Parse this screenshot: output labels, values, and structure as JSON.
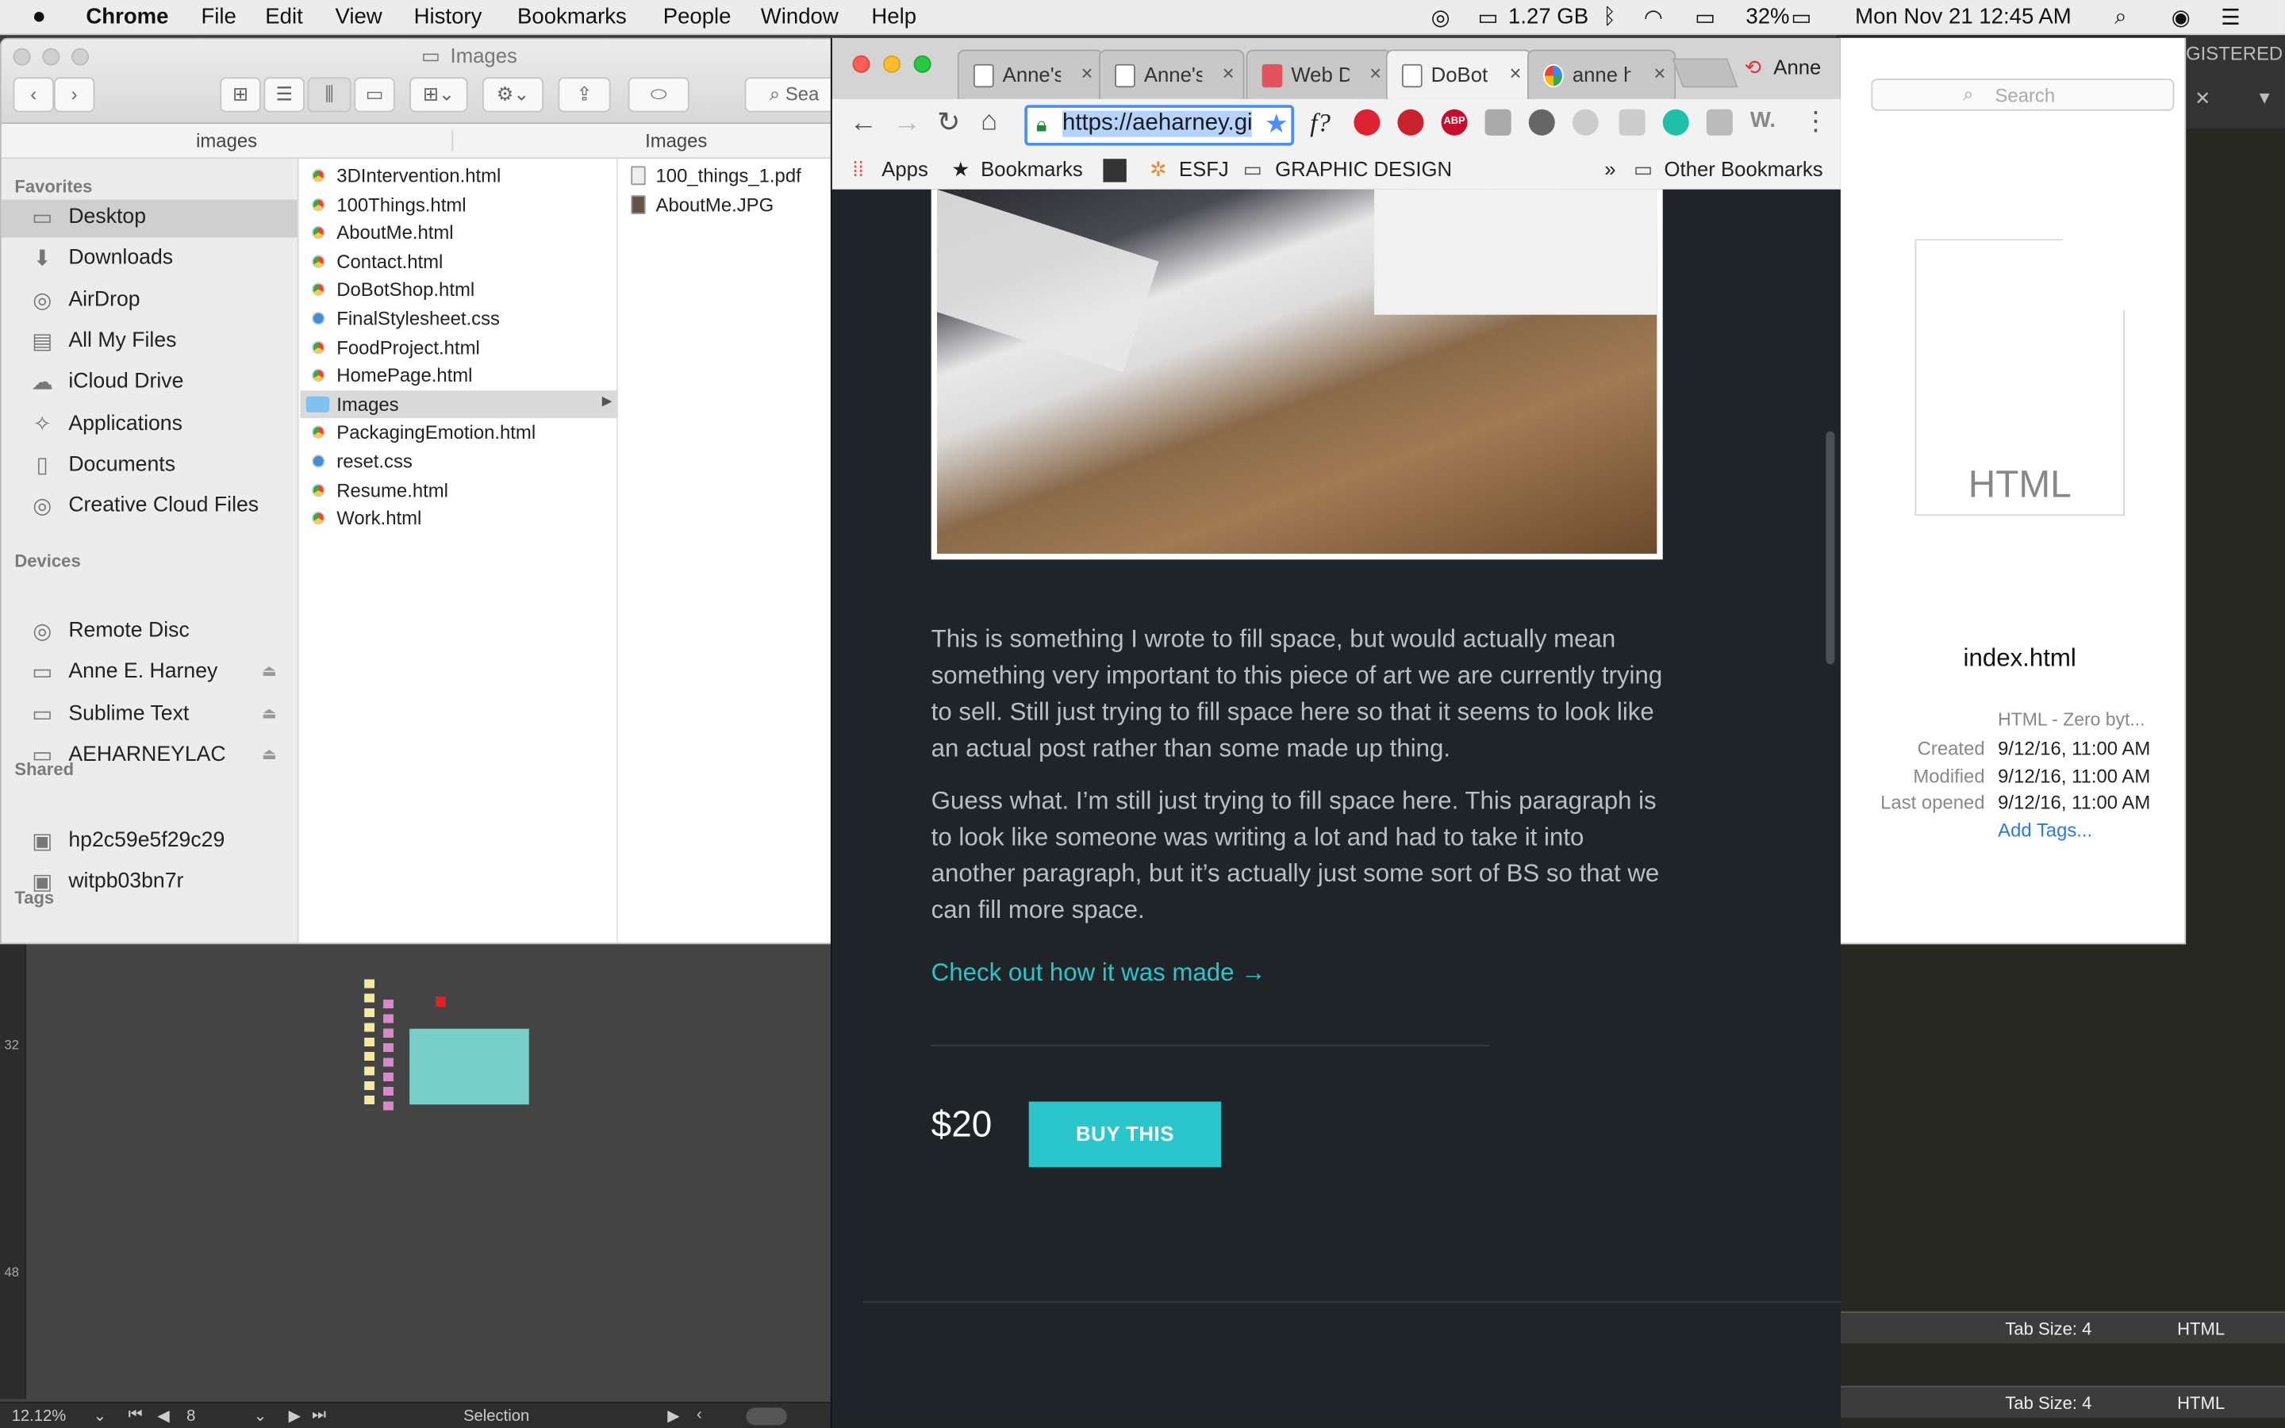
{
  "menubar": {
    "app": "Chrome",
    "items": [
      "File",
      "Edit",
      "View",
      "History",
      "Bookmarks",
      "People",
      "Window",
      "Help"
    ],
    "memory": "1.27 GB",
    "battery": "32%",
    "clock": "Mon Nov 21  12:45 AM"
  },
  "finder": {
    "title": "Images",
    "search_placeholder": "Sea",
    "col_headers": [
      "images",
      "Images"
    ],
    "favorites_label": "Favorites",
    "favorites": [
      {
        "label": "Desktop",
        "icon": "desktop-icon",
        "selected": true
      },
      {
        "label": "Downloads",
        "icon": "downloads-icon"
      },
      {
        "label": "AirDrop",
        "icon": "airdrop-icon"
      },
      {
        "label": "All My Files",
        "icon": "all-files-icon"
      },
      {
        "label": "iCloud Drive",
        "icon": "cloud-icon"
      },
      {
        "label": "Applications",
        "icon": "applications-icon"
      },
      {
        "label": "Documents",
        "icon": "documents-icon"
      },
      {
        "label": "Creative Cloud Files",
        "icon": "creative-cloud-icon"
      }
    ],
    "devices_label": "Devices",
    "devices": [
      {
        "label": "Remote Disc",
        "eject": false
      },
      {
        "label": "Anne E. Harney",
        "eject": true
      },
      {
        "label": "Sublime Text",
        "eject": true
      },
      {
        "label": "AEHARNEYLAC",
        "eject": true
      }
    ],
    "shared_label": "Shared",
    "shared": [
      "hp2c59e5f29c29",
      "witpb03bn7r"
    ],
    "tags_label": "Tags",
    "files": [
      "3DIntervention.html",
      "100Things.html",
      "AboutMe.html",
      "Contact.html",
      "DoBotShop.html",
      "FinalStylesheet.css",
      "FoodProject.html",
      "HomePage.html",
      "Images",
      "PackagingEmotion.html",
      "reset.css",
      "Resume.html",
      "Work.html"
    ],
    "images_files": [
      "100_things_1.pdf",
      "AboutMe.JPG"
    ]
  },
  "preview": {
    "search_placeholder": "Search",
    "file_type_label": "HTML",
    "filename": "index.html",
    "kind": "HTML - Zero byt...",
    "created_label": "Created",
    "created": "9/12/16, 11:00 AM",
    "modified_label": "Modified",
    "modified": "9/12/16, 11:00 AM",
    "opened_label": "Last opened",
    "opened": "9/12/16, 11:00 AM",
    "add_tags": "Add Tags..."
  },
  "chrome": {
    "tabs": [
      {
        "title": "Anne's"
      },
      {
        "title": "Anne's"
      },
      {
        "title": "Web D"
      },
      {
        "title": "DoBot",
        "active": true
      },
      {
        "title": "anne h"
      }
    ],
    "profile": "Anne",
    "url": "https://aeharney.gi",
    "bookmarks": [
      "Apps",
      "Bookmarks",
      "ESFJ",
      "GRAPHIC DESIGN"
    ],
    "other_bookmarks": "Other Bookmarks",
    "overflow": "»"
  },
  "page": {
    "para1": "This is something I wrote to fill space, but would actually mean something very important to this piece of art we are currently trying to sell. Still just trying to fill space here so that it seems to look like an actual post rather than some made up thing.",
    "para2": "Guess what. I’m still just trying to fill space here. This paragraph is to look like someone was writing a lot and had to take it into another paragraph, but it’s actually just some sort of BS so that we can fill more space.",
    "link": "Check out how it was made →",
    "price": "$20",
    "buy_label": "BUY THIS"
  },
  "sublime": {
    "tab_size": "Tab Size: 4",
    "syntax": "HTML",
    "registered": "GISTERED"
  },
  "ide": {
    "zoom": "12.12%",
    "page": "8",
    "tool": "Selection",
    "ruler_marks": [
      "32",
      "48"
    ]
  },
  "colors": {
    "accent": "#2ac6cc",
    "page_bg": "#1e2427",
    "link": "#2bc5c9"
  }
}
